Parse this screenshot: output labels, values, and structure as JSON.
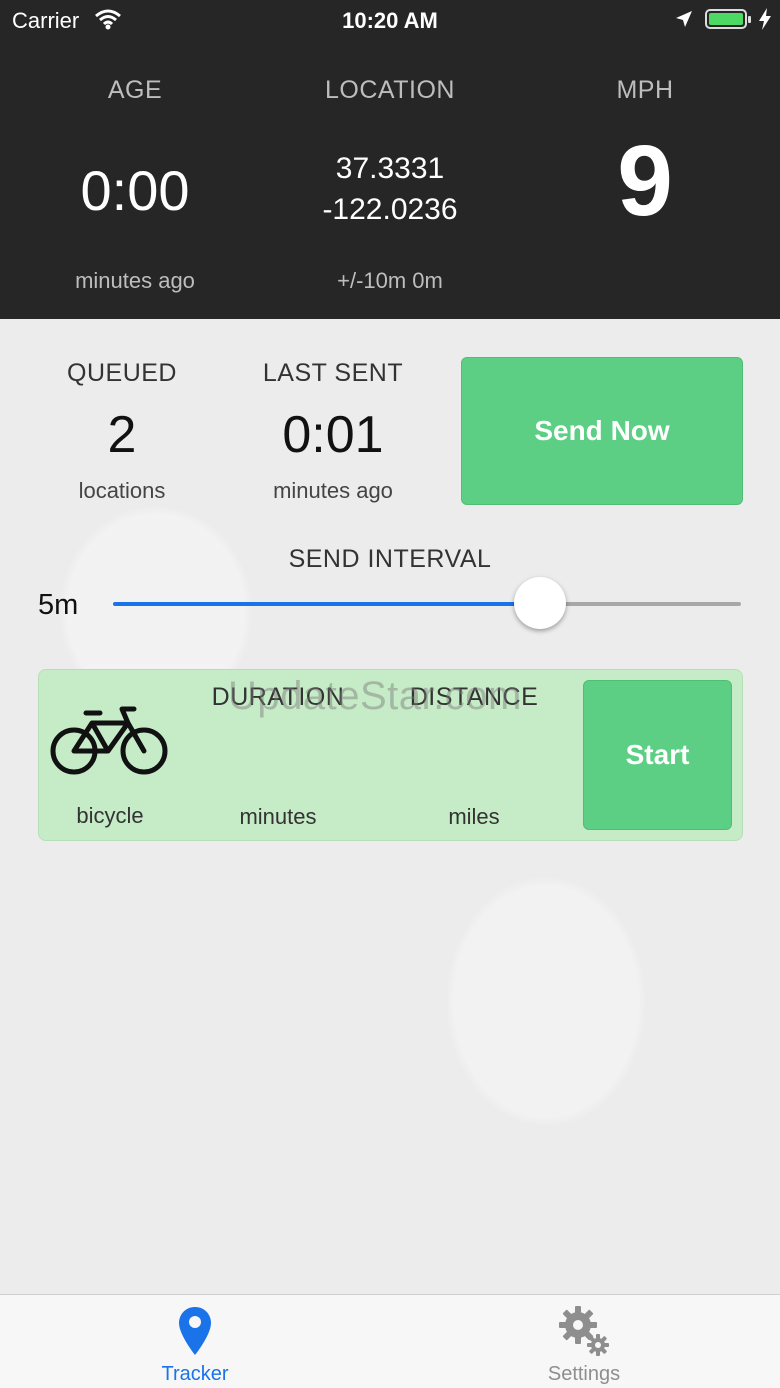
{
  "status_bar": {
    "carrier": "Carrier",
    "time": "10:20 AM"
  },
  "header": {
    "age": {
      "label": "AGE",
      "value": "0:00",
      "sub": "minutes ago"
    },
    "location": {
      "label": "LOCATION",
      "lat": "37.3331",
      "lon": "-122.0236",
      "sub": "+/-10m 0m"
    },
    "speed": {
      "label": "MPH",
      "value": "9"
    }
  },
  "queue": {
    "queued_label": "QUEUED",
    "queued_value": "2",
    "queued_sub": "locations",
    "last_sent_label": "LAST SENT",
    "last_sent_value": "0:01",
    "last_sent_sub": "minutes ago",
    "send_now_label": "Send Now"
  },
  "send_interval": {
    "label": "SEND INTERVAL",
    "value_label": "5m",
    "slider_fraction": 0.68,
    "accent_color": "#1a73e8"
  },
  "activity": {
    "duration_label": "DURATION",
    "distance_label": "DISTANCE",
    "mode_label": "bicycle",
    "duration_unit": "minutes",
    "distance_unit": "miles",
    "start_label": "Start",
    "watermark": "UpdateStar.com",
    "mode_icon": "bicycle-icon"
  },
  "tabbar": {
    "tracker_label": "Tracker",
    "settings_label": "Settings",
    "active_color": "#1a73e8",
    "inactive_color": "#8e8e8e"
  },
  "colors": {
    "header_bg": "#262626",
    "green_button": "#5ccf84",
    "panel_bg": "#c6ecc7"
  }
}
